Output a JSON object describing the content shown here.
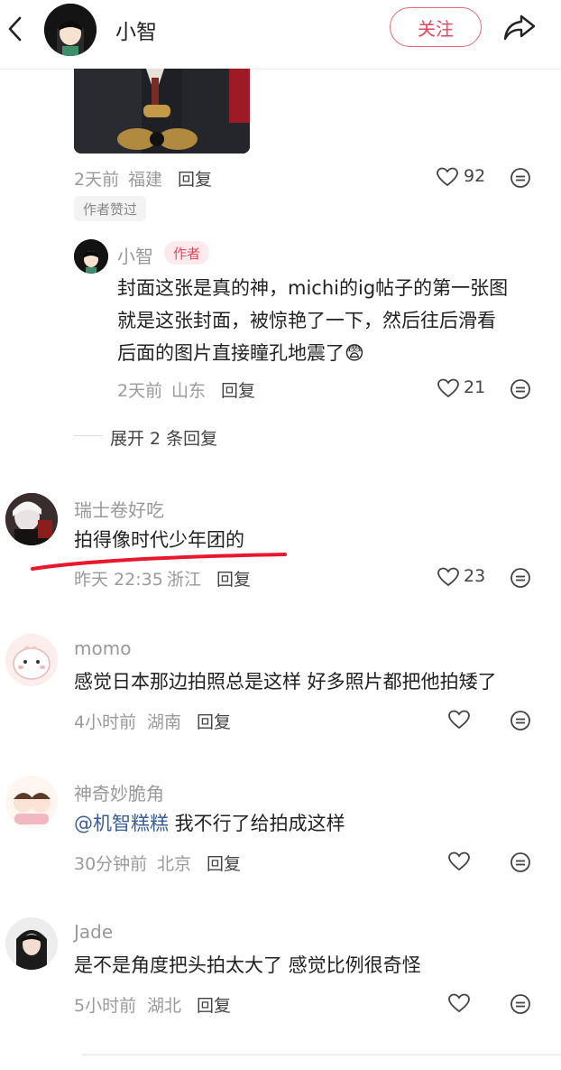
{
  "header": {
    "title": "小智",
    "follow_label": "关注"
  },
  "top_comment": {
    "time": "2天前",
    "location": "福建",
    "reply_label": "回复",
    "likes": "92",
    "liked_by_author": "作者赞过"
  },
  "author_reply": {
    "name": "小智",
    "author_tag": "作者",
    "lines": [
      "封面这张是真的神，michi的ig帖子的第一张图",
      "就是这张封面，被惊艳了一下，然后往后滑看",
      "后面的图片直接瞳孔地震了"
    ],
    "emoji": "😨",
    "time": "2天前",
    "location": "山东",
    "reply_label": "回复",
    "likes": "21"
  },
  "expand_label": "展开 2 条回复",
  "comments": [
    {
      "name": "瑞士卷好吃",
      "text": "拍得像时代少年团的",
      "time": "昨天 22:35",
      "location": "浙江",
      "reply_label": "回复",
      "likes": "23"
    },
    {
      "name": "momo",
      "text": "感觉日本那边拍照总是这样 好多照片都把他拍矮了",
      "time": "4小时前",
      "location": "湖南",
      "reply_label": "回复",
      "likes": ""
    },
    {
      "name": "神奇妙脆角",
      "mention": "@机智糕糕",
      "text": " 我不行了给拍成这样",
      "time": "30分钟前",
      "location": "北京",
      "reply_label": "回复",
      "likes": ""
    },
    {
      "name": "Jade",
      "text": "是不是角度把头拍太大了 感觉比例很奇怪",
      "time": "5小时前",
      "location": "湖北",
      "reply_label": "回复",
      "likes": ""
    }
  ],
  "colors": {
    "accent": "#e2475b",
    "annotation": "#e8192c",
    "mention": "#3a5e94"
  }
}
